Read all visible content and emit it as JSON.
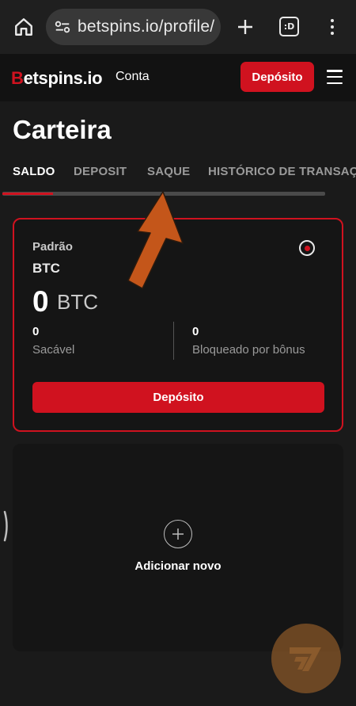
{
  "browser": {
    "url": "betspins.io/profile/",
    "tab_count_label": ":D"
  },
  "header": {
    "logo_first": "B",
    "logo_rest": "etspins.io",
    "nav_conta": "Conta",
    "deposit_label": "Depósito"
  },
  "page": {
    "title": "Carteira"
  },
  "tabs": [
    {
      "label": "SALDO",
      "active": true
    },
    {
      "label": "DEPOSIT",
      "active": false
    },
    {
      "label": "SAQUE",
      "active": false
    },
    {
      "label": "HISTÓRICO DE TRANSAÇÕES",
      "active": false
    }
  ],
  "wallet": {
    "type_label": "Padrão",
    "currency": "BTC",
    "balance": "0",
    "balance_unit": "BTC",
    "withdrawable_value": "0",
    "withdrawable_label": "Sacável",
    "bonus_locked_value": "0",
    "bonus_locked_label": "Bloqueado por bônus",
    "deposit_label": "Depósito",
    "selected": true
  },
  "add_new": {
    "label": "Adicionar novo"
  },
  "colors": {
    "accent_red": "#d0121f",
    "page_bg": "#1a1a1a",
    "card_bg": "#151515",
    "annotation_orange": "#c4561a"
  },
  "icons": [
    "home-icon",
    "site-info-icon",
    "plus-icon",
    "tabs-icon",
    "more-vert-icon",
    "hamburger-icon",
    "radio-selected-icon",
    "add-circle-icon",
    "arrow-annotation",
    "watermark-logo"
  ]
}
